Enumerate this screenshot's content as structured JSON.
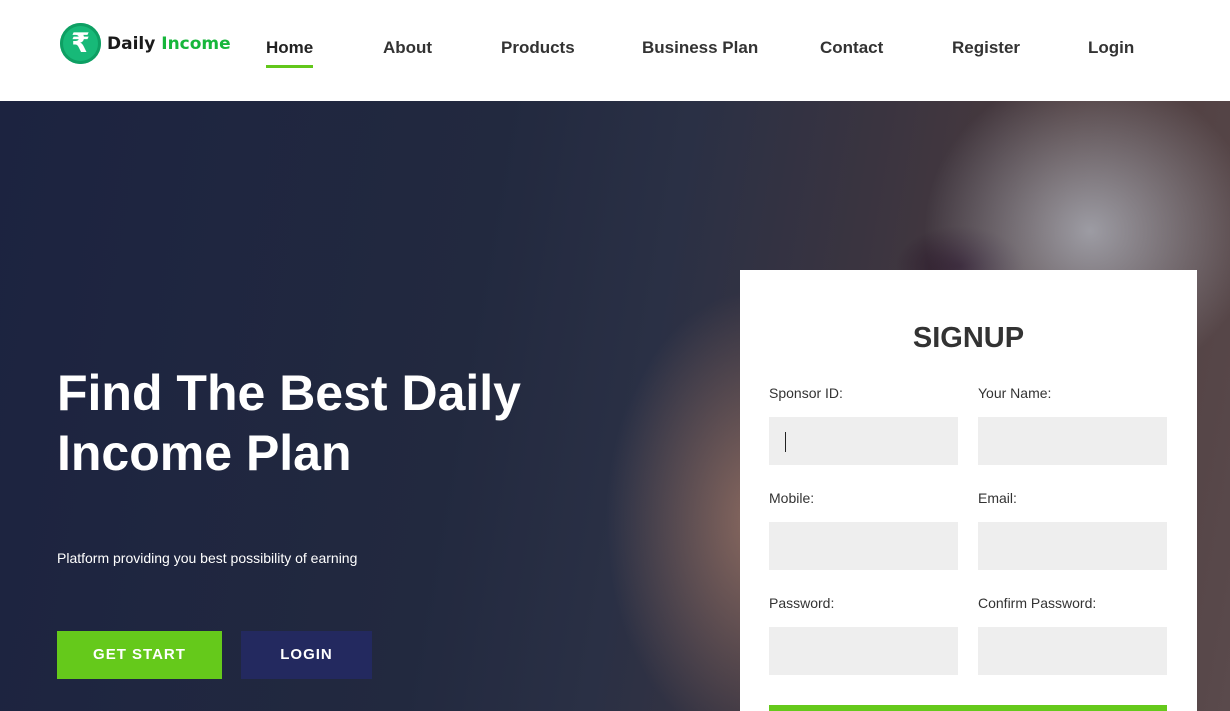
{
  "brand": {
    "logo_symbol": "₹",
    "name_part1": "Daily",
    "name_part2": "Income",
    "colors": {
      "coin": "#17b978",
      "name_accent": "#16b63b"
    }
  },
  "nav": {
    "items": [
      {
        "label": "Home",
        "active": true
      },
      {
        "label": "About"
      },
      {
        "label": "Products"
      },
      {
        "label": "Business Plan"
      },
      {
        "label": "Contact"
      },
      {
        "label": "Register"
      },
      {
        "label": "Login"
      }
    ],
    "active_underline_color": "#62c71b"
  },
  "hero": {
    "title": "Find The Best Daily Income Plan",
    "subtitle": "Platform providing you best possibility of earning",
    "buttons": {
      "start": "GET START",
      "login": "LOGIN"
    },
    "colors": {
      "start_button": "#65c91b",
      "login_button": "#23295f"
    }
  },
  "signup": {
    "title": "SIGNUP",
    "fields": {
      "sponsor_id": {
        "label": "Sponsor ID:",
        "value": ""
      },
      "your_name": {
        "label": "Your Name:",
        "value": ""
      },
      "mobile": {
        "label": "Mobile:",
        "value": ""
      },
      "email": {
        "label": "Email:",
        "value": ""
      },
      "password": {
        "label": "Password:",
        "value": ""
      },
      "confirm_password": {
        "label": "Confirm Password:",
        "value": ""
      }
    },
    "focused_field": "sponsor_id"
  }
}
